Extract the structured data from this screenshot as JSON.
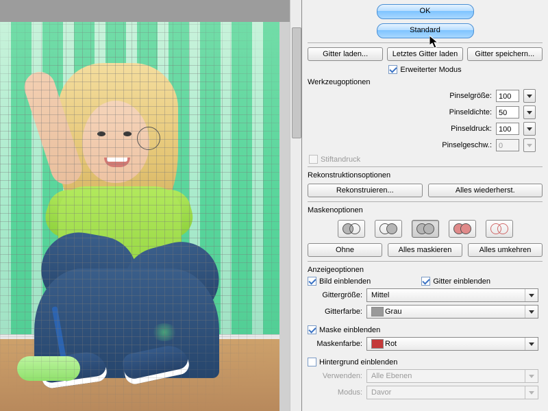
{
  "dialog": {
    "ok": "OK",
    "standard": "Standard",
    "load_mesh": "Gitter laden...",
    "load_last": "Letztes Gitter laden",
    "save_mesh": "Gitter speichern...",
    "advanced_mode": "Erweiterter Modus"
  },
  "tool_options": {
    "title": "Werkzeugoptionen",
    "brush_size_label": "Pinselgröße:",
    "brush_size": "100",
    "brush_density_label": "Pinseldichte:",
    "brush_density": "50",
    "brush_pressure_label": "Pinseldruck:",
    "brush_pressure": "100",
    "brush_rate_label": "Pinselgeschw.:",
    "brush_rate": "0",
    "stylus_pressure": "Stiftandruck"
  },
  "reconstruct": {
    "title": "Rekonstruktionsoptionen",
    "reconstruct_btn": "Rekonstruieren...",
    "restore_all_btn": "Alles wiederherst."
  },
  "mask": {
    "title": "Maskenoptionen",
    "none": "Ohne",
    "mask_all": "Alles maskieren",
    "invert_all": "Alles umkehren"
  },
  "view": {
    "title": "Anzeigeoptionen",
    "show_image": "Bild einblenden",
    "show_mesh": "Gitter einblenden",
    "mesh_size_label": "Gittergröße:",
    "mesh_size_value": "Mittel",
    "mesh_color_label": "Gitterfarbe:",
    "mesh_color_value": "Grau",
    "show_mask": "Maske einblenden",
    "mask_color_label": "Maskenfarbe:",
    "mask_color_value": "Rot",
    "show_backdrop": "Hintergrund einblenden",
    "use_label": "Verwenden:",
    "use_value": "Alle Ebenen",
    "mode_label": "Modus:",
    "mode_value": "Davor"
  }
}
